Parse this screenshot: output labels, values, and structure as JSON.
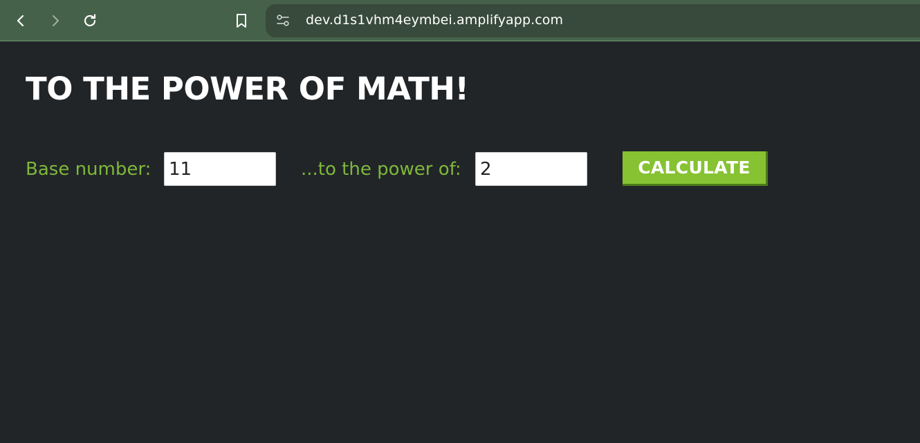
{
  "browser": {
    "url": "dev.d1s1vhm4eymbei.amplifyapp.com",
    "icons": {
      "back": "chevron-left-icon",
      "forward": "chevron-right-icon",
      "reload": "reload-icon",
      "bookmark": "bookmark-icon",
      "site_info": "tune-icon"
    },
    "colors": {
      "toolbar": "#45614a",
      "address_bar": "#384a3c"
    }
  },
  "page": {
    "title": "TO THE POWER OF MATH!",
    "base_label": "Base number:",
    "base_value": "11",
    "power_label": "...to the power of:",
    "power_value": "2",
    "calculate_label": "CALCULATE",
    "colors": {
      "background": "#222528",
      "label": "#7db83a",
      "button": "#86c232",
      "button_shadow": "#4c7a1c",
      "title": "#ffffff"
    }
  }
}
